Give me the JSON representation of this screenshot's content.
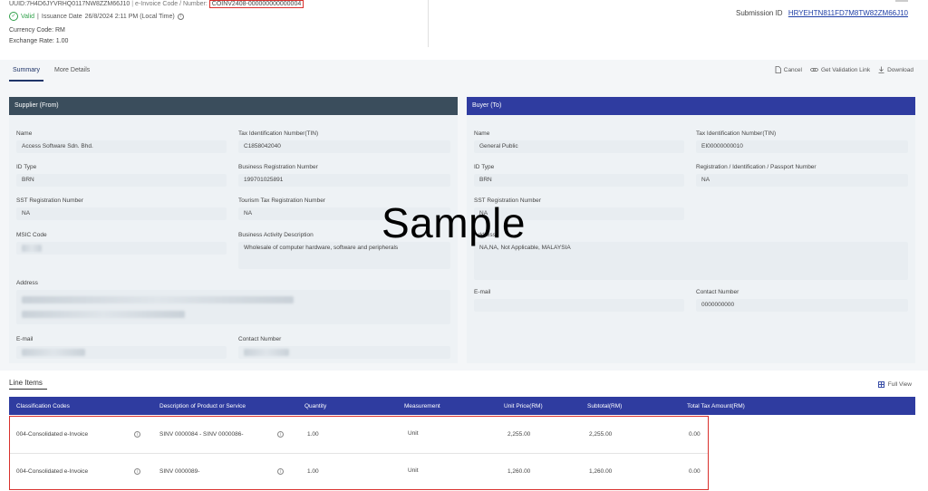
{
  "header": {
    "uuid_label": "UUID:",
    "uuid": "7H4D6JYVRHQ0117NW8ZZM66J10",
    "invoice_code_label": "e-Invoice Code / Number:",
    "invoice_code": "COINV2408-000000000000004",
    "status": "Valid",
    "issuance_label": "Issuance Date",
    "issuance_date": "26/8/2024 2:11 PM (Local Time)",
    "currency_label": "Currency Code: RM",
    "exchange_label": "Exchange Rate: 1.00",
    "submission_label": "Submission ID",
    "submission_id": "HRYEHTN811FD7M8TW82ZM66J10"
  },
  "tabs": {
    "summary": "Summary",
    "more": "More Details"
  },
  "actions": {
    "cancel": "Cancel",
    "validation": "Get Validation Link",
    "download": "Download"
  },
  "supplier": {
    "title": "Supplier (From)",
    "name_label": "Name",
    "name": "Access Software Sdn. Bhd.",
    "tin_label": "Tax Identification Number(TIN)",
    "tin": "C1858042040",
    "idtype_label": "ID Type",
    "idtype": "BRN",
    "brn_label": "Business Registration Number",
    "brn": "199701025891",
    "sst_label": "SST Registration Number",
    "sst": "NA",
    "tourism_label": "Tourism Tax Registration Number",
    "tourism": "NA",
    "msic_label": "MSIC Code",
    "activity_label": "Business Activity Description",
    "activity": "Wholesale of computer hardware, software and peripherals",
    "address_label": "Address",
    "email_label": "E-mail",
    "contact_label": "Contact Number"
  },
  "buyer": {
    "title": "Buyer (To)",
    "name_label": "Name",
    "name": "General Public",
    "tin_label": "Tax Identification Number(TIN)",
    "tin": "EI00000000010",
    "idtype_label": "ID Type",
    "idtype": "BRN",
    "reg_label": "Registration / Identification / Passport Number",
    "reg": "NA",
    "sst_label": "SST Registration Number",
    "sst": "NA",
    "address_label": "Address",
    "address": "NA,NA, Not Applicable, MALAYSIA",
    "email_label": "E-mail",
    "contact_label": "Contact Number",
    "contact": "0000000000"
  },
  "watermark": "Sample",
  "line_items": {
    "title": "Line Items",
    "full_view": "Full View",
    "columns": [
      "Classification Codes",
      "Description of Product or Service",
      "Quantity",
      "Measurement",
      "Unit Price(RM)",
      "Subtotal(RM)",
      "Total Tax Amount(RM)"
    ],
    "rows": [
      [
        "004-Consolidated e-Invoice",
        "SINV 0000084 - SINV 0000086-",
        "1.00",
        "Unit",
        "2,255.00",
        "2,255.00",
        "0.00"
      ],
      [
        "004-Consolidated e-Invoice",
        "SINV 0000089-",
        "1.00",
        "Unit",
        "1,260.00",
        "1,260.00",
        "0.00"
      ]
    ]
  }
}
